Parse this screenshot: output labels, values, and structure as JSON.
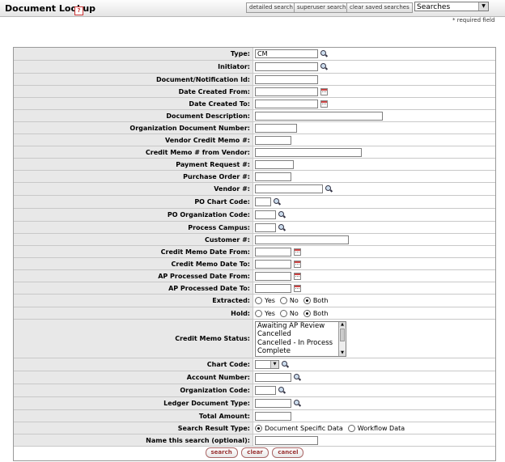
{
  "header": {
    "title": "Document Lookup",
    "help": "?",
    "buttons": [
      "detailed search",
      "superuser search",
      "clear saved searches"
    ],
    "searches_select": "Searches",
    "required_note": "* required field"
  },
  "form": {
    "type": {
      "label": "Type:",
      "value": "CM"
    },
    "initiator": {
      "label": "Initiator:",
      "value": ""
    },
    "doc_id": {
      "label": "Document/Notification Id:",
      "value": ""
    },
    "date_from": {
      "label": "Date Created From:",
      "value": ""
    },
    "date_to": {
      "label": "Date Created To:",
      "value": ""
    },
    "description": {
      "label": "Document Description:",
      "value": ""
    },
    "org_doc_number": {
      "label": "Organization Document Number:",
      "value": ""
    },
    "vendor_credit_memo": {
      "label": "Vendor Credit Memo #:",
      "value": ""
    },
    "credit_memo_from_vendor": {
      "label": "Credit Memo # from Vendor:",
      "value": ""
    },
    "payment_request": {
      "label": "Payment Request #:",
      "value": ""
    },
    "purchase_order": {
      "label": "Purchase Order #:",
      "value": ""
    },
    "vendor": {
      "label": "Vendor #:",
      "value": ""
    },
    "po_chart_code": {
      "label": "PO Chart Code:",
      "value": ""
    },
    "po_org_code": {
      "label": "PO Organization Code:",
      "value": ""
    },
    "process_campus": {
      "label": "Process Campus:",
      "value": ""
    },
    "customer": {
      "label": "Customer #:",
      "value": ""
    },
    "cm_date_from": {
      "label": "Credit Memo Date From:",
      "value": ""
    },
    "cm_date_to": {
      "label": "Credit Memo Date To:",
      "value": ""
    },
    "ap_date_from": {
      "label": "AP Processed Date From:",
      "value": ""
    },
    "ap_date_to": {
      "label": "AP Processed Date To:",
      "value": ""
    },
    "extracted": {
      "label": "Extracted:",
      "options": [
        "Yes",
        "No",
        "Both"
      ],
      "selected": "Both"
    },
    "hold": {
      "label": "Hold:",
      "options": [
        "Yes",
        "No",
        "Both"
      ],
      "selected": "Both"
    },
    "status": {
      "label": "Credit Memo Status:",
      "options": [
        "Awaiting AP Review",
        "Cancelled",
        "Cancelled - In Process",
        "Complete"
      ]
    },
    "chart_code": {
      "label": "Chart Code:",
      "value": ""
    },
    "account_number": {
      "label": "Account Number:",
      "value": ""
    },
    "org_code": {
      "label": "Organization Code:",
      "value": ""
    },
    "ledger_doc_type": {
      "label": "Ledger Document Type:",
      "value": ""
    },
    "total_amount": {
      "label": "Total Amount:",
      "value": ""
    },
    "result_type": {
      "label": "Search Result Type:",
      "options": [
        "Document Specific Data",
        "Workflow Data"
      ],
      "selected": "Document Specific Data"
    },
    "search_name": {
      "label": "Name this search (optional):",
      "value": ""
    }
  },
  "actions": {
    "search": "search",
    "clear": "clear",
    "cancel": "cancel"
  }
}
